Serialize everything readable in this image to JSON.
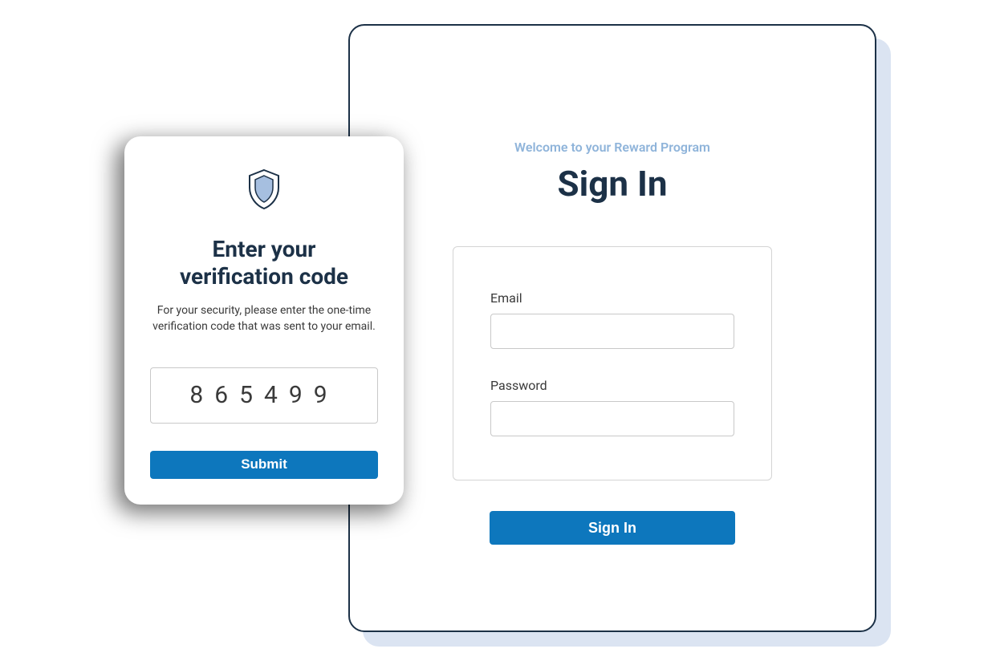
{
  "signin": {
    "welcome": "Welcome to your Reward Program",
    "title": "Sign In",
    "email_label": "Email",
    "email_value": "",
    "password_label": "Password",
    "password_value": "",
    "button_label": "Sign In"
  },
  "verify": {
    "icon": "shield-icon",
    "title_line1": "Enter your",
    "title_line2": "verification code",
    "description": "For your security, please enter the one-time verification code that was sent to your email.",
    "code_value": "865499",
    "submit_label": "Submit"
  },
  "colors": {
    "primary_button": "#0d77bd",
    "dark_text": "#1c3147",
    "welcome_text": "#8fb4da",
    "shadow_panel": "#dbe4f2",
    "shield_fill": "#a6bfe0",
    "shield_stroke": "#1c3147"
  }
}
